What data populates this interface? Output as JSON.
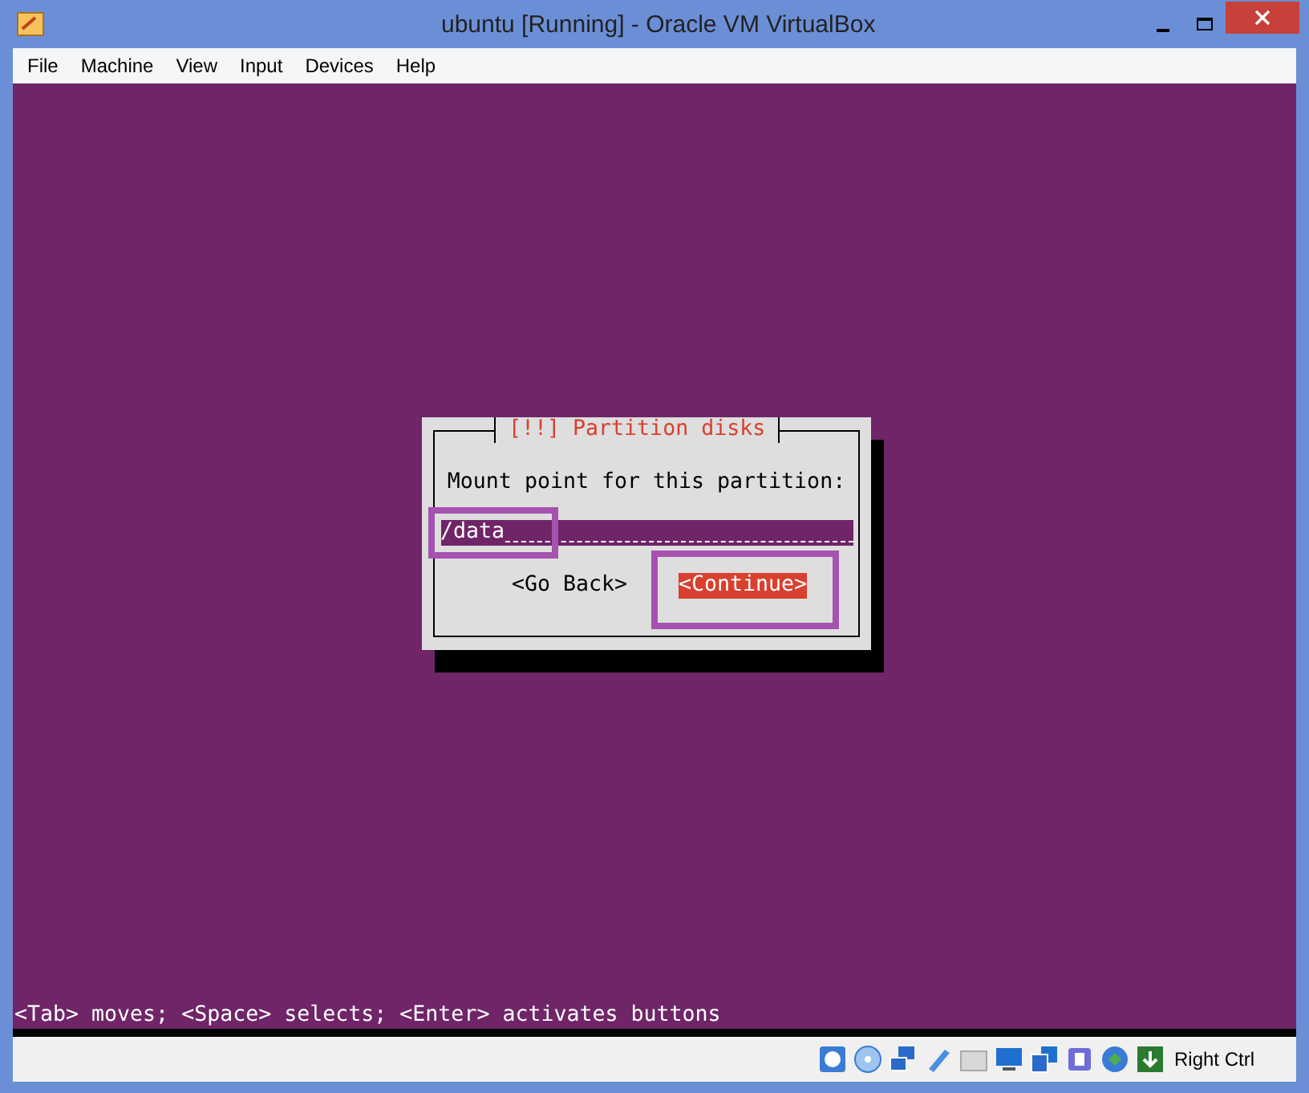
{
  "window": {
    "title": "ubuntu [Running] - Oracle VM VirtualBox"
  },
  "menu": [
    "File",
    "Machine",
    "View",
    "Input",
    "Devices",
    "Help"
  ],
  "dialog": {
    "title": "[!!] Partition disks",
    "prompt": "Mount point for this partition:",
    "field": {
      "value": "/data"
    },
    "buttons": [
      {
        "label": "<Go Back>",
        "selected": false
      },
      {
        "label": "<Continue>",
        "selected": true
      }
    ]
  },
  "hint": "<Tab> moves; <Space> selects; <Enter> activates buttons",
  "status_bar": {
    "host_key": "Right Ctrl"
  }
}
